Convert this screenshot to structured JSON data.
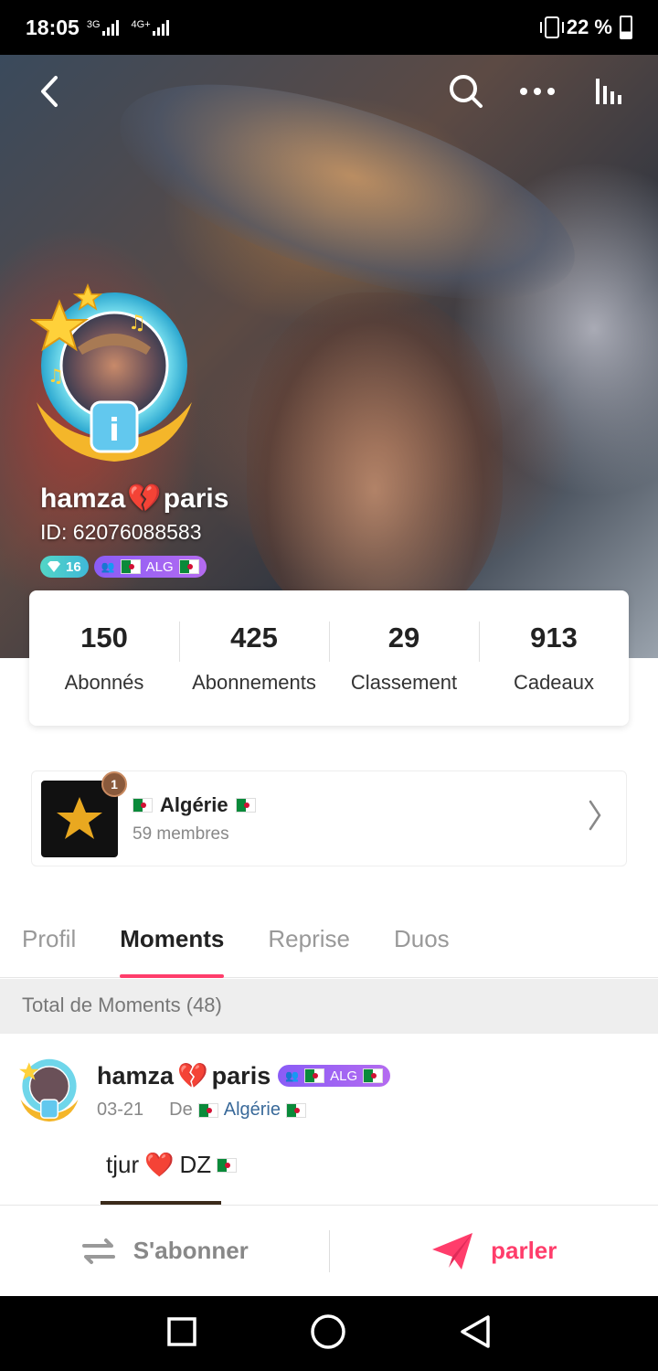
{
  "status_bar": {
    "time": "18:05",
    "network_1": "3G",
    "network_2": "4G+",
    "battery": "22 %"
  },
  "header": {
    "back_icon": "chevron-left-icon",
    "search_icon": "search-icon",
    "more_icon": "more-horizontal-icon",
    "stats_icon": "bar-chart-icon"
  },
  "profile": {
    "username_part1": "hamza",
    "username_emoji": "💔",
    "username_part2": "paris",
    "id_text": "ID: 62076088583",
    "level": "16",
    "family_tag": "ALG"
  },
  "stats": [
    {
      "value": "150",
      "label": "Abonnés"
    },
    {
      "value": "425",
      "label": "Abonnements"
    },
    {
      "value": "29",
      "label": "Classement"
    },
    {
      "value": "913",
      "label": "Cadeaux"
    }
  ],
  "family": {
    "rank": "1",
    "name": "Algérie",
    "members": "59 membres"
  },
  "tabs": [
    {
      "label": "Profil",
      "active": false
    },
    {
      "label": "Moments",
      "active": true
    },
    {
      "label": "Reprise",
      "active": false
    },
    {
      "label": "Duos",
      "active": false
    }
  ],
  "moments_total": "Total de Moments (48)",
  "post": {
    "user_part1": "hamza",
    "user_emoji": "💔",
    "user_part2": "paris",
    "family_tag": "ALG",
    "date": "03-21",
    "from_label": "De",
    "from_place": "Algérie",
    "text_part1": "tjur",
    "text_heart": "❤️",
    "text_part2": "DZ"
  },
  "actions": {
    "follow_label": "S'abonner",
    "talk_label": "parler"
  },
  "colors": {
    "accent": "#ff3d6b",
    "level_badge": "#3fb8d8",
    "family_badge": "#8a5cf6"
  }
}
